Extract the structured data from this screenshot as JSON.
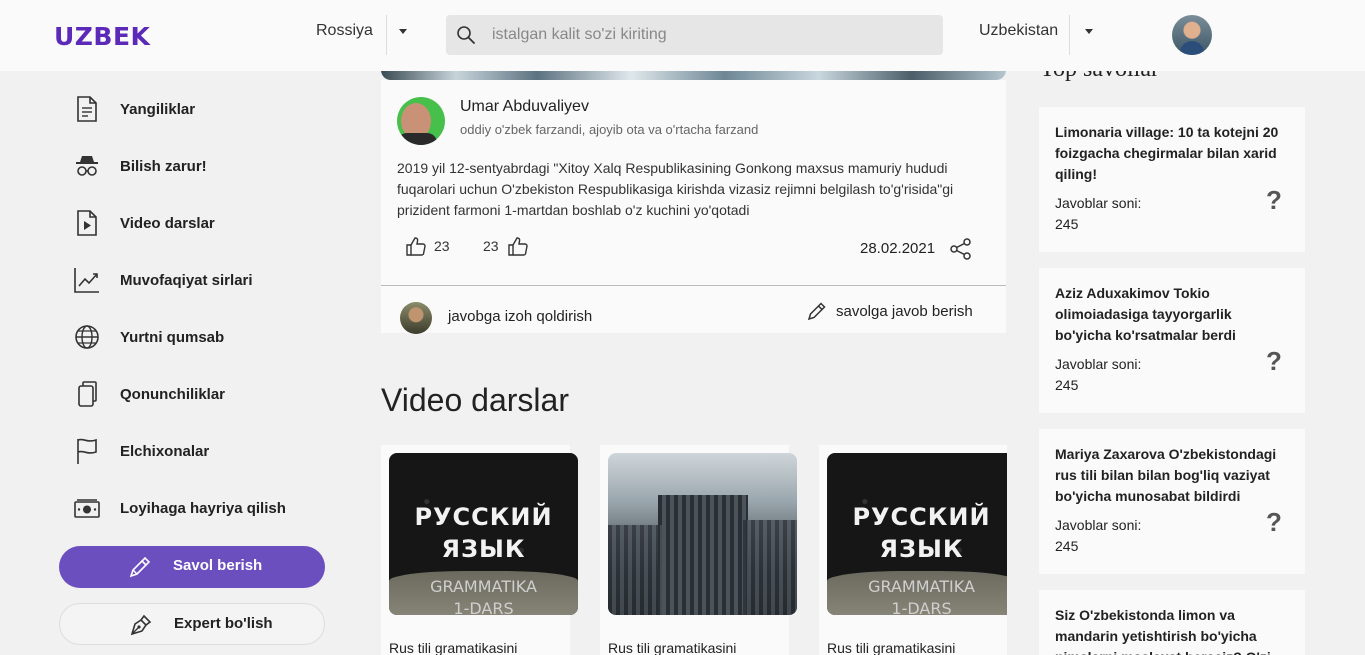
{
  "header": {
    "logo": "UZBEK",
    "country": "Rossiya",
    "search_placeholder": "istalgan kalit so'zi kiriting",
    "language": "Uzbekistan"
  },
  "sidebar": {
    "items": [
      {
        "label": "Yangiliklar",
        "icon": "document-icon"
      },
      {
        "label": "Bilish zarur!",
        "icon": "spy-icon"
      },
      {
        "label": "Video darslar",
        "icon": "video-file-icon"
      },
      {
        "label": "Muvofaqiyat sirlari",
        "icon": "chart-line-icon"
      },
      {
        "label": "Yurtni qumsab",
        "icon": "globe-icon"
      },
      {
        "label": "Qonunchiliklar",
        "icon": "copy-icon"
      },
      {
        "label": "Elchixonalar",
        "icon": "flag-icon"
      },
      {
        "label": "Loyihaga hayriya qilish",
        "icon": "money-icon"
      }
    ],
    "ask_button": "Savol berish",
    "expert_button": "Expert bo'lish"
  },
  "post": {
    "author": "Umar Abduvaliyev",
    "bio": "oddiy o'zbek farzandi, ajoyib ota va o'rtacha farzand",
    "text": "2019 yil 12-sentyabrdagi \"Xitoy Xalq Respublikasining Gonkong maxsus mamuriy hududi fuqarolari uchun O'zbekiston Respublikasiga kirishda vizasiz rejimni belgilash to'g'risida\"gi prizident farmoni 1-martdan boshlab o'z kuchini yo'qotadi",
    "likes_left": "23",
    "likes_right": "23",
    "date": "28.02.2021",
    "comment_label": "javobga izoh qoldirish",
    "answer_label": "savolga javob berish"
  },
  "videos": {
    "section_title": "Video darslar",
    "thumb_text_line1": "РУССКИЙ",
    "thumb_text_line2": "ЯЗЫК",
    "thumb_text_line3": "GRAMMATIKA",
    "thumb_text_line4": "1-DARS",
    "items": [
      {
        "title": "Rus tili gramatikasini"
      },
      {
        "title": "Rus tili gramatikasini"
      },
      {
        "title": "Rus tili gramatikasini"
      }
    ]
  },
  "top_questions": {
    "title": "Top savollar",
    "answers_label": "Javoblar soni:",
    "items": [
      {
        "text": "Limonaria village: 10 ta kotejni 20 foizgacha chegirmalar bilan xarid qiling!",
        "answers": "245"
      },
      {
        "text": "Aziz Aduxakimov Tokio olimoiadasiga tayyorgarlik bo'yicha ko'rsatmalar berdi",
        "answers": "245"
      },
      {
        "text": "Mariya Zaxarova O'zbekistondagi rus tili bilan bilan bog'liq vaziyat bo'yicha munosabat bildirdi",
        "answers": "245"
      },
      {
        "text": "Siz O'zbekistonda limon va mandarin yetishtirish bo'yicha nimalarni maslaxat berasiz? O'zi",
        "answers": ""
      }
    ]
  },
  "colors": {
    "brand": "#5b2ab8",
    "primary_button": "#6c4fbf",
    "background": "#f1f1f1",
    "card": "#fafafa"
  }
}
